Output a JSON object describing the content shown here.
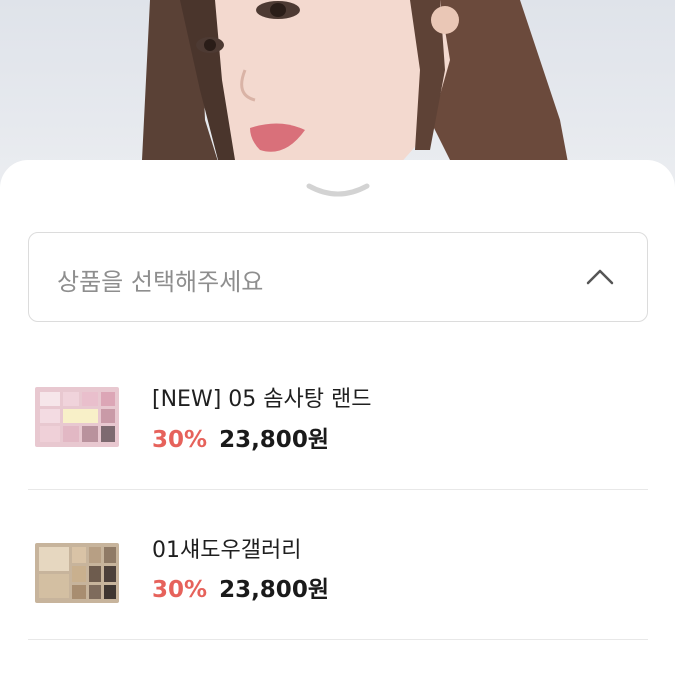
{
  "hero": {
    "image": "model-portrait"
  },
  "sheet": {
    "handle_icon": "chevron-down-icon"
  },
  "select": {
    "placeholder": "상품을 선택해주세요",
    "chevron_icon": "chevron-up-icon"
  },
  "products": [
    {
      "name": "[NEW] 05 솜사탕 랜드",
      "discount": "30%",
      "price": "23,800원",
      "thumbnail": "pink-eyeshadow-palette"
    },
    {
      "name": "01섀도우갤러리",
      "discount": "30%",
      "price": "23,800원",
      "thumbnail": "brown-eyeshadow-palette"
    }
  ],
  "colors": {
    "discount": "#e6625b",
    "price": "#1a1a1a",
    "placeholder": "#8e8e8e",
    "border": "#dcdcdc"
  }
}
